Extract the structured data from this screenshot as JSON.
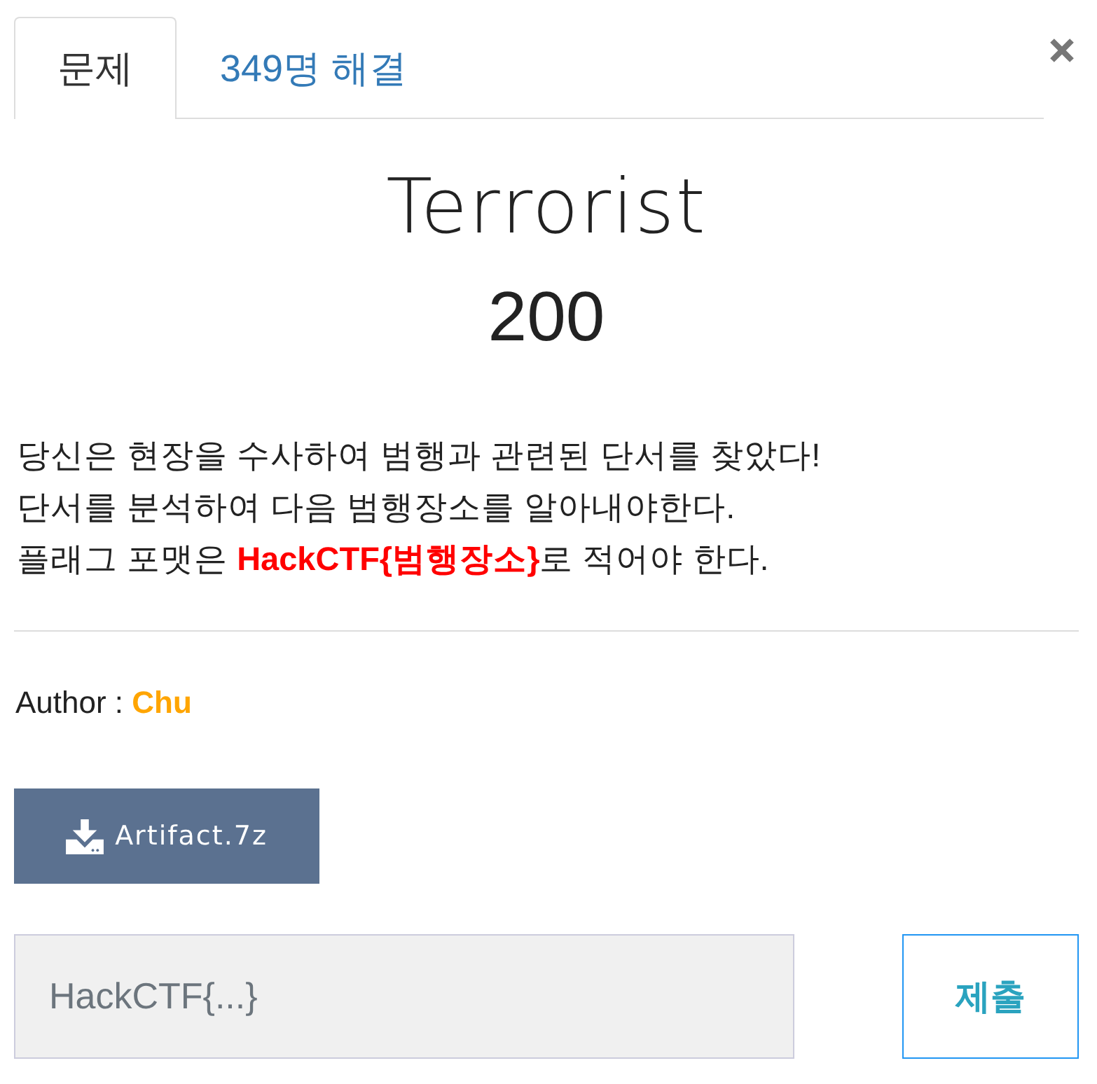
{
  "tabs": [
    {
      "label": "문제",
      "selected": true
    },
    {
      "label": "349명 해결",
      "selected": false
    }
  ],
  "challenge": {
    "title": "Terrorist",
    "points": "200",
    "description": [
      "당신은 현장을 수사하여 범행과 관련된 단서를 찾았다!",
      "단서를 분석하여 다음 범행장소를 알아내야한다.",
      "플래그 포맷은 **HackCTF{범행장소}**로 적어야 한다."
    ],
    "author": {
      "label": "Author :",
      "name": "Chu"
    }
  },
  "download": {
    "label": "Artifact.7z"
  },
  "flag_form": {
    "placeholder": "HackCTF{...}",
    "submit": "제출"
  }
}
